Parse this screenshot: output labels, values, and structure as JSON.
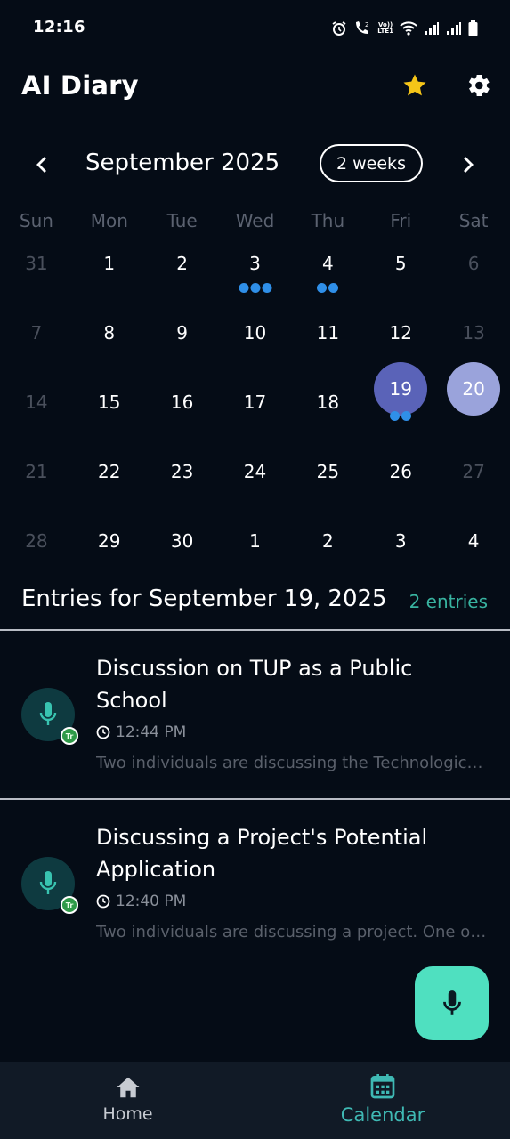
{
  "status_bar": {
    "time": "12:16",
    "volte_top": "Vo))",
    "volte_bottom": "LTE1"
  },
  "header": {
    "title": "AI Diary"
  },
  "calendar": {
    "month_title": "September 2025",
    "view_toggle": "2 weeks",
    "weekdays": [
      "Sun",
      "Mon",
      "Tue",
      "Wed",
      "Thu",
      "Fri",
      "Sat"
    ],
    "weeks": [
      [
        {
          "d": "31",
          "muted": true,
          "dots": 0
        },
        {
          "d": "1",
          "dots": 0
        },
        {
          "d": "2",
          "dots": 0
        },
        {
          "d": "3",
          "dots": 3
        },
        {
          "d": "4",
          "dots": 2
        },
        {
          "d": "5",
          "dots": 0
        },
        {
          "d": "6",
          "muted": true,
          "dots": 0
        }
      ],
      [
        {
          "d": "7",
          "muted": true,
          "dots": 0
        },
        {
          "d": "8",
          "dots": 0
        },
        {
          "d": "9",
          "dots": 0
        },
        {
          "d": "10",
          "dots": 0
        },
        {
          "d": "11",
          "dots": 0
        },
        {
          "d": "12",
          "dots": 0
        },
        {
          "d": "13",
          "muted": true,
          "dots": 0
        }
      ],
      [
        {
          "d": "14",
          "muted": true,
          "dots": 0
        },
        {
          "d": "15",
          "dots": 0
        },
        {
          "d": "16",
          "dots": 0
        },
        {
          "d": "17",
          "dots": 0
        },
        {
          "d": "18",
          "dots": 0
        },
        {
          "d": "19",
          "selected": true,
          "dots": 2
        },
        {
          "d": "20",
          "today": true,
          "dots": 0
        }
      ],
      [
        {
          "d": "21",
          "muted": true,
          "dots": 0
        },
        {
          "d": "22",
          "dots": 0
        },
        {
          "d": "23",
          "dots": 0
        },
        {
          "d": "24",
          "dots": 0
        },
        {
          "d": "25",
          "dots": 0
        },
        {
          "d": "26",
          "dots": 0
        },
        {
          "d": "27",
          "muted": true,
          "dots": 0
        }
      ],
      [
        {
          "d": "28",
          "muted": true,
          "dots": 0
        },
        {
          "d": "29",
          "dots": 0
        },
        {
          "d": "30",
          "dots": 0
        },
        {
          "d": "1",
          "dots": 0
        },
        {
          "d": "2",
          "dots": 0
        },
        {
          "d": "3",
          "dots": 0
        },
        {
          "d": "4",
          "dots": 0
        }
      ]
    ]
  },
  "entries_section": {
    "title": "Entries for September 19, 2025",
    "count": "2 entries",
    "entries": [
      {
        "title": "Discussion on TUP as a Public School",
        "time": "12:44 PM",
        "snippet": "Two individuals are discussing the Technological University of the Philippines",
        "badge": "Tr"
      },
      {
        "title": "Discussing a Project's Potential Application",
        "time": "12:40 PM",
        "snippet": "Two individuals are discussing a project. One of them explains its uses",
        "badge": "Tr"
      }
    ]
  },
  "bottom_nav": {
    "home_label": "Home",
    "calendar_label": "Calendar"
  },
  "colors": {
    "accent": "#4fe0c0",
    "selected_day": "#5a63b8",
    "today": "#9aa3db",
    "dot": "#2f8fe8",
    "star": "#f5c518"
  },
  "icons": {
    "star": "star-icon",
    "settings": "gear-icon",
    "mic": "microphone-icon",
    "home": "home-icon",
    "calendar": "calendar-icon"
  }
}
